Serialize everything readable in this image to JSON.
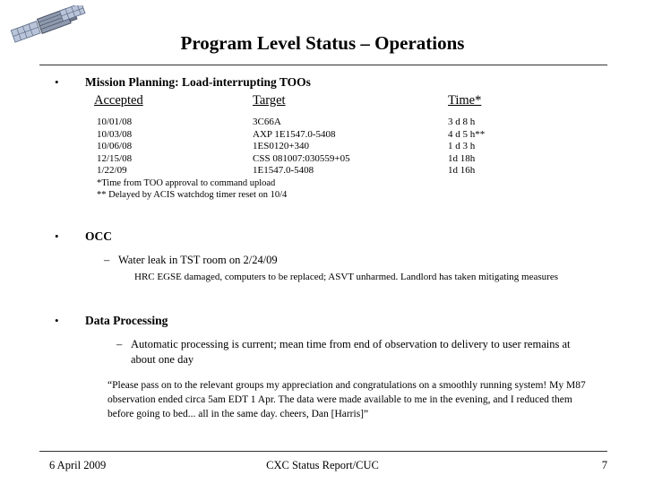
{
  "slide": {
    "title": "Program Level Status – Operations",
    "logo_icon": "satellite-icon"
  },
  "sections": {
    "mission_planning": {
      "bullet": "•",
      "heading": "Mission Planning: Load-interrupting TOOs",
      "table": {
        "headers": [
          "Accepted",
          "Target",
          "Time*"
        ],
        "rows": [
          {
            "accepted": "10/01/08",
            "target": "3C66A",
            "time": "3 d 8 h"
          },
          {
            "accepted": "10/03/08",
            "target": "AXP 1E1547.0-5408",
            "time": "4 d 5 h**"
          },
          {
            "accepted": "10/06/08",
            "target": "1ES0120+340",
            "time": "1 d 3 h"
          },
          {
            "accepted": "12/15/08",
            "target": "CSS 081007:030559+05",
            "time": "1d 18h"
          },
          {
            "accepted": "1/22/09",
            "target": "1E1547.0-5408",
            "time": "1d 16h"
          }
        ],
        "notes": [
          "*Time from TOO approval to command upload",
          "** Delayed by ACIS watchdog timer reset on 10/4"
        ]
      }
    },
    "occ": {
      "bullet": "•",
      "heading": "OCC",
      "sub_bullet": "–",
      "sub_text": "Water leak in TST room on 2/24/09",
      "detail": "HRC EGSE damaged, computers to be replaced; ASVT unharmed. Landlord has taken mitigating measures"
    },
    "data_processing": {
      "bullet": "•",
      "heading": "Data Processing",
      "sub_bullet": "–",
      "sub_text": "Automatic processing is current; mean time from end of observation to delivery to user remains at about one day",
      "quote": "“Please pass on to the relevant groups my appreciation and congratulations on a smoothly running system!  My M87 observation ended circa 5am EDT 1 Apr. The data were made available to me in the evening, and I reduced them before going to bed... all in the same day.  cheers, Dan [Harris]”"
    }
  },
  "footer": {
    "date": "6 April 2009",
    "center": "CXC Status Report/CUC",
    "page": "7"
  }
}
